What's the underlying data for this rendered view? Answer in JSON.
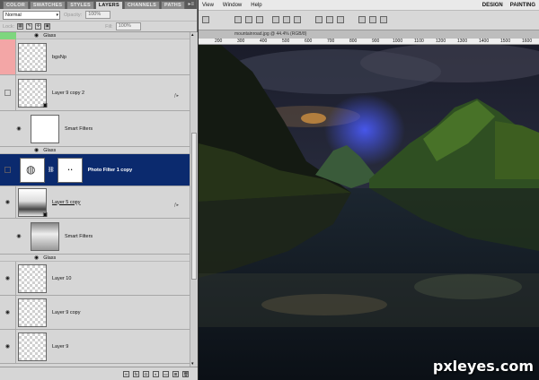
{
  "panel": {
    "tabs": [
      "COLOR",
      "SWATCHES",
      "STYLES",
      "LAYERS",
      "CHANNELS",
      "PATHS"
    ],
    "active_tab": "LAYERS",
    "blend_mode": "Normal",
    "opacity_label": "Opacity:",
    "opacity_value": "100%",
    "lock_label": "Lock:",
    "fill_label": "Fill:",
    "fill_value": "100%"
  },
  "layers": {
    "glass_top": "Glass",
    "bgshp": "bgsNp",
    "layer9copy2": "Layer 9 copy 2",
    "smart_filters_1": "Smart Filters",
    "glass_1": "Glass",
    "photo_filter": "Photo Filter 1 copy",
    "layer5copy": "Layer 5 copy",
    "smart_filters_2": "Smart Filters",
    "glass_2": "Glass",
    "layer10": "Layer 10",
    "layer9copy": "Layer 9 copy",
    "layer9": "Layer 9"
  },
  "menubar": {
    "items": [
      "View",
      "Window",
      "Help"
    ],
    "workspaces": [
      "DESIGN",
      "PAINTING"
    ]
  },
  "document": {
    "tab_title": "mountainroad.jpg @ 44.4% (RGB/8)",
    "ruler_ticks": [
      "200",
      "300",
      "400",
      "500",
      "600",
      "700",
      "800",
      "900",
      "1000",
      "1100",
      "1200",
      "1300",
      "1400",
      "1500",
      "1600"
    ]
  },
  "watermark": "pxleyes.com",
  "colors": {
    "selected": "#0b2a6e",
    "panel_bg": "#d6d6d6",
    "indicator_pink": "#f3a6a6",
    "indicator_green": "#7ed67e"
  }
}
